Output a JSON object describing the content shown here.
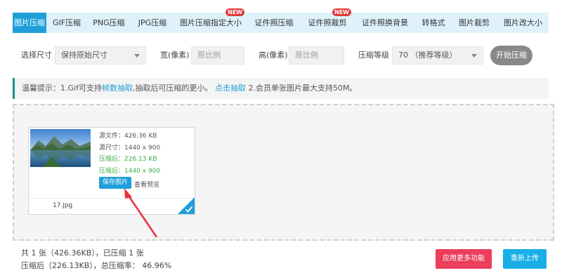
{
  "tabs": [
    {
      "label": "图片压缩",
      "active": true,
      "new": false
    },
    {
      "label": "GIF压缩",
      "active": false,
      "new": false
    },
    {
      "label": "PNG压缩",
      "active": false,
      "new": false
    },
    {
      "label": "JPG压缩",
      "active": false,
      "new": false
    },
    {
      "label": "图片压缩指定大小",
      "active": false,
      "new": true
    },
    {
      "label": "证件照压缩",
      "active": false,
      "new": false
    },
    {
      "label": "证件照裁剪",
      "active": false,
      "new": true
    },
    {
      "label": "证件照换背景",
      "active": false,
      "new": false
    },
    {
      "label": "转格式",
      "active": false,
      "new": false
    },
    {
      "label": "图片裁剪",
      "active": false,
      "new": false
    },
    {
      "label": "图片改大小",
      "active": false,
      "new": false
    }
  ],
  "new_badge": "NEW",
  "options": {
    "size_label": "选择尺寸",
    "size_value": "保持原始尺寸",
    "width_label": "宽(像素)",
    "width_placeholder": "原比例",
    "height_label": "高(像素)",
    "height_placeholder": "原比例",
    "level_label": "压缩等级",
    "level_value": "70 （推荐等级）",
    "start_button": "开始压缩"
  },
  "tip": {
    "prefix": "温馨提示：1.Gif可支持",
    "link1": "帧数抽取",
    "middle": ",抽取后可压缩的更小。",
    "link2": "点击抽取",
    "suffix": " 2.会员单张图片最大支持50M。"
  },
  "card": {
    "source_file": "源文件：426.36 KB",
    "source_size": "源尺寸：1440 x 900",
    "compressed": "压缩后：226.13 KB",
    "compressed_size": "压缩后：1440 x 900",
    "save_button": "保存图片",
    "preview_link": "查看预览",
    "filename": "17.jpg"
  },
  "summary": {
    "line1": "共 1 张（426.36KB），已压缩 1 张",
    "line2": "压缩后（226.13KB），总压缩率： 46.96%"
  },
  "buttons": {
    "more": "应用更多功能",
    "reupload": "重新上传"
  },
  "colors": {
    "accent": "#1f9fd8",
    "tab_bg": "#dff1fb",
    "green": "#3cb043",
    "red": "#ea3e5b",
    "arrow": "#e8323c"
  }
}
